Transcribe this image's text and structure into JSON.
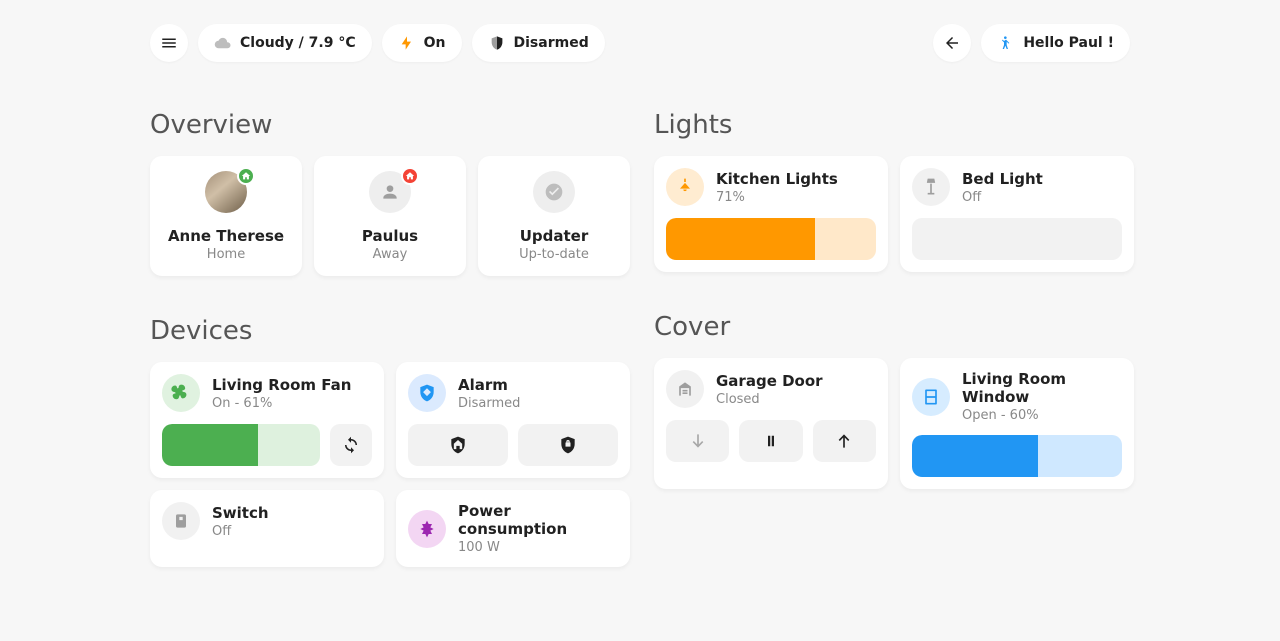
{
  "header": {
    "chips": {
      "weather": "Cloudy / 7.9 °C",
      "lights_on": "On",
      "alarm": "Disarmed",
      "greeting": "Hello Paul !"
    }
  },
  "overview": {
    "title": "Overview",
    "people": [
      {
        "name": "Anne Therese",
        "status": "Home",
        "badge_color": "#4caf50"
      },
      {
        "name": "Paulus",
        "status": "Away",
        "badge_color": "#f44336"
      },
      {
        "name": "Updater",
        "status": "Up-to-date"
      }
    ]
  },
  "devices": {
    "title": "Devices",
    "fan": {
      "title": "Living Room Fan",
      "sub": "On - 61%",
      "percent": 61
    },
    "alarm": {
      "title": "Alarm",
      "sub": "Disarmed"
    },
    "switch": {
      "title": "Switch",
      "sub": "Off"
    },
    "power": {
      "title": "Power consumption",
      "sub": "100 W"
    }
  },
  "lights": {
    "title": "Lights",
    "kitchen": {
      "title": "Kitchen Lights",
      "sub": "71%",
      "percent": 71
    },
    "bed": {
      "title": "Bed Light",
      "sub": "Off"
    }
  },
  "cover": {
    "title": "Cover",
    "garage": {
      "title": "Garage Door",
      "sub": "Closed"
    },
    "window": {
      "title": "Living Room Window",
      "sub": "Open - 60%",
      "percent": 60
    }
  }
}
